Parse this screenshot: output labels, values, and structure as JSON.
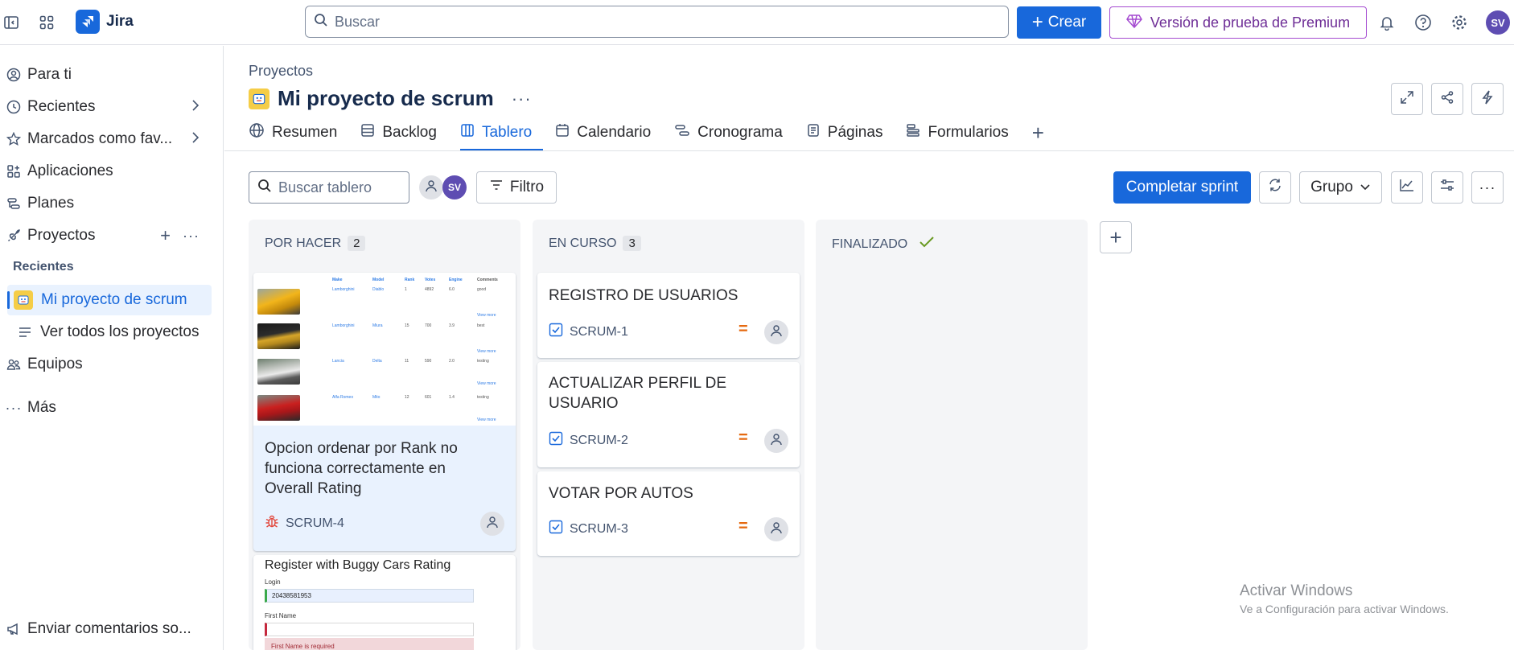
{
  "topbar": {
    "app_name": "Jira",
    "search_placeholder": "Buscar",
    "create_label": "Crear",
    "premium_label": "Versión de prueba de Premium",
    "user_initials": "SV"
  },
  "sidebar": {
    "items": [
      {
        "label": "Para ti"
      },
      {
        "label": "Recientes"
      },
      {
        "label": "Marcados como fav..."
      },
      {
        "label": "Aplicaciones"
      },
      {
        "label": "Planes"
      },
      {
        "label": "Proyectos"
      }
    ],
    "recent_heading": "Recientes",
    "active_project": "Mi proyecto de scrum",
    "view_all": "Ver todos los proyectos",
    "teams": "Equipos",
    "more": "Más",
    "feedback": "Enviar comentarios so..."
  },
  "project": {
    "breadcrumb": "Proyectos",
    "title": "Mi proyecto de scrum"
  },
  "tabs": [
    {
      "label": "Resumen"
    },
    {
      "label": "Backlog"
    },
    {
      "label": "Tablero"
    },
    {
      "label": "Calendario"
    },
    {
      "label": "Cronograma"
    },
    {
      "label": "Páginas"
    },
    {
      "label": "Formularios"
    }
  ],
  "toolbar": {
    "search_placeholder": "Buscar tablero",
    "filter_label": "Filtro",
    "avatar_initials": "SV",
    "complete_sprint": "Completar sprint",
    "group_label": "Grupo"
  },
  "columns": [
    {
      "name": "POR HACER",
      "count": "2"
    },
    {
      "name": "EN CURSO",
      "count": "3"
    },
    {
      "name": "FINALIZADO"
    }
  ],
  "cards": {
    "todo": [
      {
        "title": "Opcion ordenar por Rank no funciona correctamente en Overall Rating",
        "key": "SCRUM-4",
        "thumb": {
          "headers": [
            "Make",
            "Model",
            "Rank",
            "Votes",
            "Engine",
            "Comments"
          ],
          "rows": [
            {
              "make": "Lamborghini",
              "model": "Diablo",
              "rank": "1",
              "votes": "4892",
              "engine": "6.0",
              "comment": "good"
            },
            {
              "make": "Lamborghini",
              "model": "Miura",
              "rank": "15",
              "votes": "700",
              "engine": "3.9",
              "comment": "best"
            },
            {
              "make": "Lancia",
              "model": "Delta",
              "rank": "11",
              "votes": "590",
              "engine": "2.0",
              "comment": "testing"
            },
            {
              "make": "Alfa Romeo",
              "model": "Mito",
              "rank": "12",
              "votes": "601",
              "engine": "1.4",
              "comment": "testing"
            }
          ],
          "view_more": "View more"
        }
      },
      {
        "title": "Register with Buggy Cars Rating",
        "form": {
          "login_label": "Login",
          "login_value": "20438581953",
          "first_name_label": "First Name",
          "error": "First Name is required"
        }
      }
    ],
    "in_progress": [
      {
        "title": "REGISTRO DE USUARIOS",
        "key": "SCRUM-1"
      },
      {
        "title": "ACTUALIZAR PERFIL DE USUARIO",
        "key": "SCRUM-2"
      },
      {
        "title": "VOTAR POR AUTOS",
        "key": "SCRUM-3"
      }
    ]
  },
  "watermark": {
    "line1": "Activar Windows",
    "line2": "Ve a Configuración para activar Windows."
  },
  "colors": {
    "brand": "#1868db",
    "premium": "#a54cd1",
    "priority": "#e56910",
    "bug": "#e2483d",
    "done_check": "#6a9a23"
  }
}
